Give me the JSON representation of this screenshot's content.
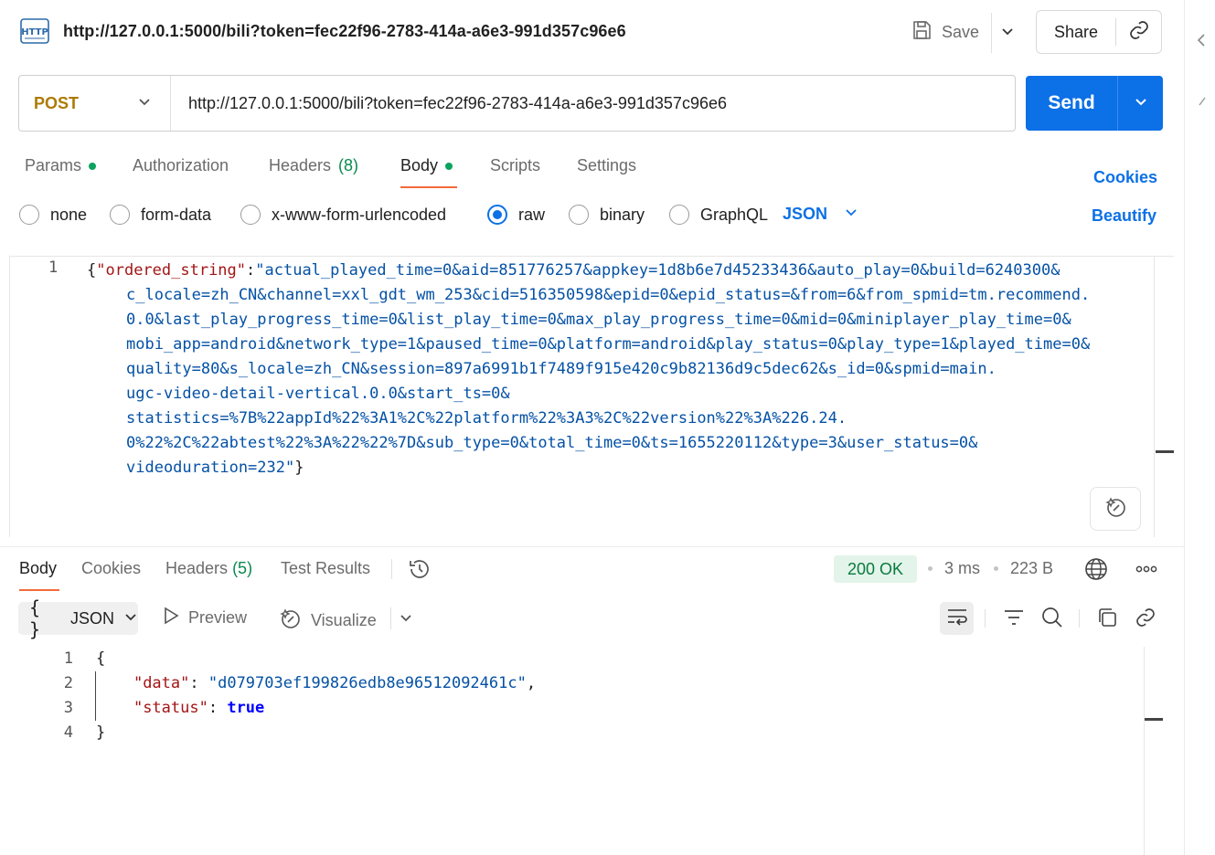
{
  "header": {
    "title": "http://127.0.0.1:5000/bili?token=fec22f96-2783-414a-a6e3-991d357c96e6",
    "save_label": "Save",
    "share_label": "Share"
  },
  "request": {
    "method": "POST",
    "url": "http://127.0.0.1:5000/bili?token=fec22f96-2783-414a-a6e3-991d357c96e6",
    "send_label": "Send"
  },
  "request_tabs": [
    {
      "label": "Params",
      "dot": true
    },
    {
      "label": "Authorization"
    },
    {
      "label": "Headers",
      "count": "(8)"
    },
    {
      "label": "Body",
      "dot": true,
      "active": true
    },
    {
      "label": "Scripts"
    },
    {
      "label": "Settings"
    }
  ],
  "links": {
    "cookies": "Cookies",
    "beautify": "Beautify"
  },
  "body_types": [
    {
      "label": "none",
      "selected": false
    },
    {
      "label": "form-data",
      "selected": false
    },
    {
      "label": "x-www-form-urlencoded",
      "selected": false
    },
    {
      "label": "raw",
      "selected": true
    },
    {
      "label": "binary",
      "selected": false
    },
    {
      "label": "GraphQL",
      "selected": false
    }
  ],
  "body_language": "JSON",
  "request_body": {
    "line_number": "1",
    "key": "\"ordered_string\"",
    "value_lines": [
      "\"actual_played_time=0&aid=851776257&appkey=1d8b6e7d45233436&auto_play=0&build=6240300&",
      "c_locale=zh_CN&channel=xxl_gdt_wm_253&cid=516350598&epid=0&epid_status=&from=6&from_spmid=tm.recommend.",
      "0.0&last_play_progress_time=0&list_play_time=0&max_play_progress_time=0&mid=0&miniplayer_play_time=0&",
      "mobi_app=android&network_type=1&paused_time=0&platform=android&play_status=0&play_type=1&played_time=0&",
      "quality=80&s_locale=zh_CN&session=897a6991b1f7489f915e420c9b82136d9c5dec62&s_id=0&spmid=main.",
      "ugc-video-detail-vertical.0.0&start_ts=0&",
      "statistics=%7B%22appId%22%3A1%2C%22platform%22%3A3%2C%22version%22%3A%226.24.",
      "0%22%2C%22abtest%22%3A%22%22%7D&sub_type=0&total_time=0&ts=1655220112&type=3&user_status=0&",
      "videoduration=232\""
    ]
  },
  "response": {
    "tabs": [
      {
        "label": "Body",
        "active": true
      },
      {
        "label": "Cookies"
      },
      {
        "label": "Headers",
        "count": "(5)"
      },
      {
        "label": "Test Results"
      }
    ],
    "status": "200 OK",
    "time": "3 ms",
    "size": "223 B",
    "format": "JSON",
    "preview_label": "Preview",
    "visualize_label": "Visualize",
    "line_numbers": [
      "1",
      "2",
      "3",
      "4"
    ],
    "open_brace": "{",
    "close_brace": "}",
    "data_key": "\"data\"",
    "data_value": "\"d079703ef199826edb8e96512092461c\"",
    "status_key": "\"status\"",
    "status_value": "true"
  },
  "colors": {
    "accent": "#0c70e6",
    "method": "#ad7a03",
    "tab_underline": "#f26b3a",
    "status_ok_bg": "#e3f4ea",
    "status_ok_text": "#0a7a3f",
    "json_key": "#a31515",
    "json_string": "#0451a5",
    "json_bool": "#0000ff"
  }
}
